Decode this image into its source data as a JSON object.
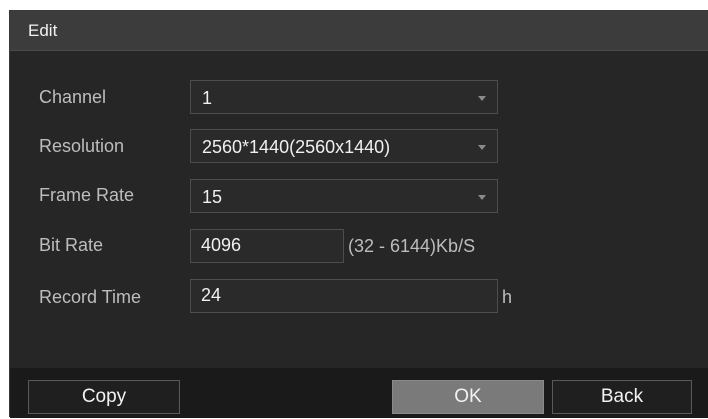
{
  "dialog": {
    "title": "Edit"
  },
  "form": {
    "channel": {
      "label": "Channel",
      "value": "1"
    },
    "resolution": {
      "label": "Resolution",
      "value": "2560*1440(2560x1440)"
    },
    "frame_rate": {
      "label": "Frame Rate",
      "value": "15"
    },
    "bit_rate": {
      "label": "Bit Rate",
      "value": "4096",
      "range": "(32 - 6144)Kb/S"
    },
    "record_time": {
      "label": "Record Time",
      "value": "24",
      "unit": "h"
    }
  },
  "footer": {
    "copy_label": "Copy",
    "ok_label": "OK",
    "back_label": "Back"
  }
}
